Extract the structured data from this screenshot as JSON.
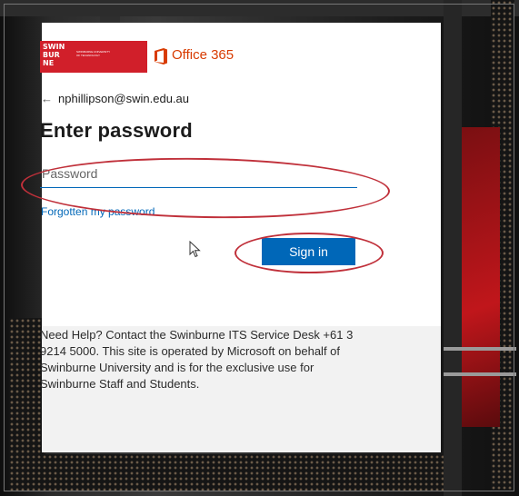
{
  "brand": {
    "university_wordmark": "SWIN BUR NE",
    "university_tagline": "SWINBURNE UNIVERSITY OF TECHNOLOGY",
    "office_label": "Office 365",
    "office_color": "#d83b01",
    "university_color": "#d11f2a"
  },
  "account": {
    "back_icon": "arrow-left-icon",
    "email": "nphillipson@swin.edu.au"
  },
  "form": {
    "title": "Enter password",
    "password_placeholder": "Password",
    "forgot_link": "Forgotten my password",
    "signin_label": "Sign in",
    "accent_color": "#0067b8"
  },
  "help": {
    "text": "Need Help? Contact the Swinburne ITS Service Desk +61 3 9214 5000. This site is operated by Microsoft on behalf of Swinburne University and is for the exclusive use for Swinburne Staff and Students."
  },
  "annotations": {
    "highlight_color": "#c0303a"
  }
}
